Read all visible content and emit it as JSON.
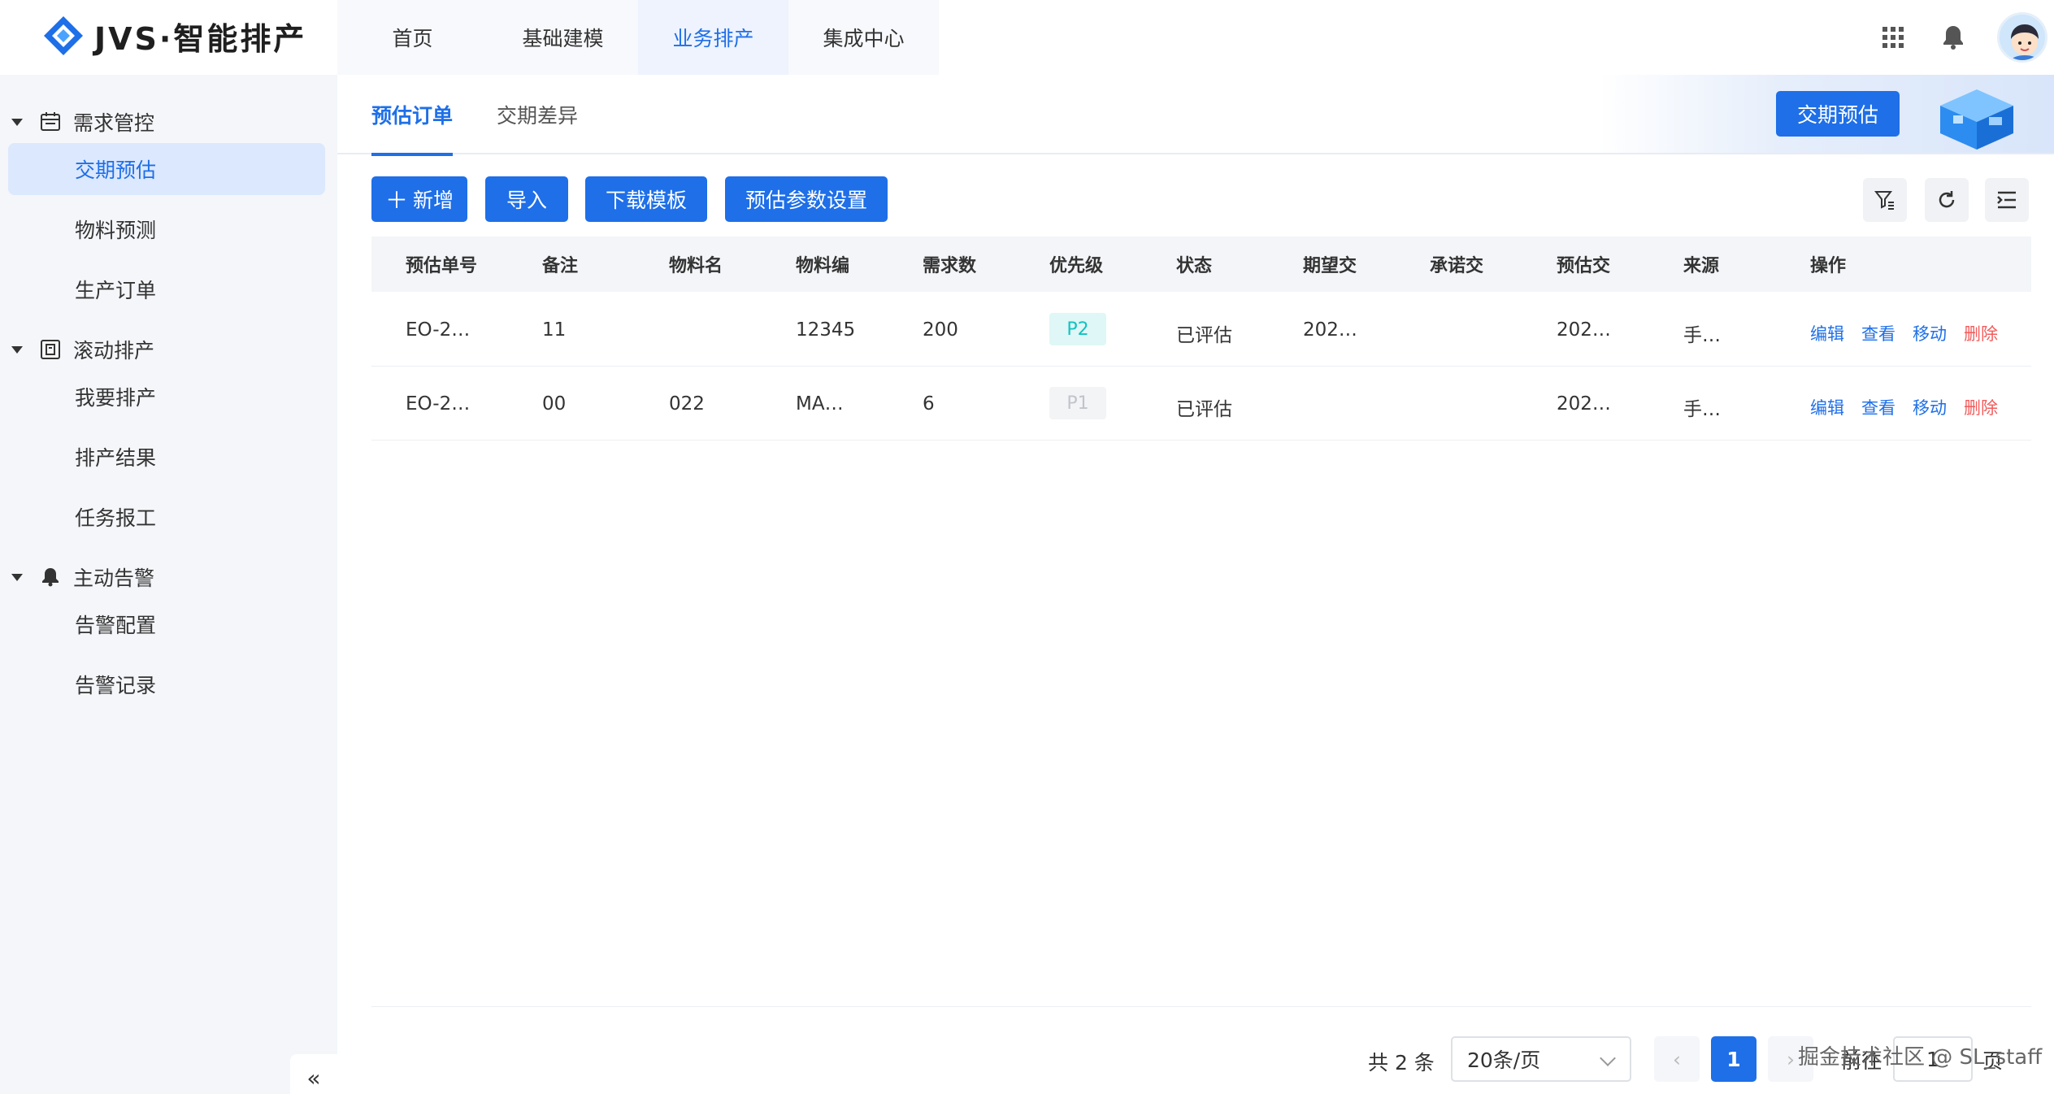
{
  "app": {
    "logo_text": "JVS·智能排产",
    "brand_color": "#1e6fe8"
  },
  "topnav": {
    "items": [
      {
        "label": "首页"
      },
      {
        "label": "基础建模"
      },
      {
        "label": "业务排产"
      },
      {
        "label": "集成中心"
      }
    ],
    "active_index": 2
  },
  "header_icons": [
    "apps-grid-icon",
    "bell-icon",
    "user-avatar"
  ],
  "sidebar": {
    "groups": [
      {
        "label": "需求管控",
        "icon": "calendar-icon",
        "items": [
          {
            "label": "交期预估"
          },
          {
            "label": "物料预测"
          },
          {
            "label": "生产订单"
          }
        ]
      },
      {
        "label": "滚动排产",
        "icon": "schedule-icon",
        "items": [
          {
            "label": "我要排产"
          },
          {
            "label": "排产结果"
          },
          {
            "label": "任务报工"
          }
        ]
      },
      {
        "label": "主动告警",
        "icon": "bell-icon",
        "items": [
          {
            "label": "告警配置"
          },
          {
            "label": "告警记录"
          }
        ]
      }
    ],
    "active_item": "交期预估",
    "collapse_label": "«"
  },
  "tabs": [
    {
      "label": "预估订单"
    },
    {
      "label": "交期差异"
    }
  ],
  "banner": {
    "button_label": "交期预估"
  },
  "toolbar": {
    "add_label": "新增",
    "import_label": "导入",
    "download_label": "下载模板",
    "settings_label": "预估参数设置",
    "tool_icons": [
      "filter-icon",
      "refresh-icon",
      "column-settings-icon"
    ]
  },
  "table": {
    "columns": [
      "预估单号",
      "备注",
      "物料名",
      "物料编",
      "需求数",
      "优先级",
      "状态",
      "期望交",
      "承诺交",
      "预估交",
      "来源",
      "操作"
    ],
    "rows": [
      {
        "order_no": "EO-2…",
        "remark": "11",
        "material_name": "",
        "material_code": "12345",
        "qty": "200",
        "priority": "P2",
        "status": "已评估",
        "expected": "202…",
        "promised": "",
        "estimated": "202…",
        "source": "手…"
      },
      {
        "order_no": "EO-2…",
        "remark": "00",
        "material_name": "022",
        "material_code": "MA…",
        "qty": "6",
        "priority": "P1",
        "status": "已评估",
        "expected": "",
        "promised": "",
        "estimated": "202…",
        "source": "手…"
      }
    ],
    "actions": {
      "edit": "编辑",
      "view": "查看",
      "move": "移动",
      "delete": "删除"
    },
    "priority_colors": {
      "P2": "#13c2c2",
      "P1": "#c0c4cc"
    }
  },
  "pagination": {
    "total": "共 2 条",
    "page_size": "20条/页",
    "current_page": "1",
    "goto_label": "前往",
    "goto_value": "1",
    "page_unit": "页"
  },
  "watermark": "掘金技术社区 @ SL_staff"
}
